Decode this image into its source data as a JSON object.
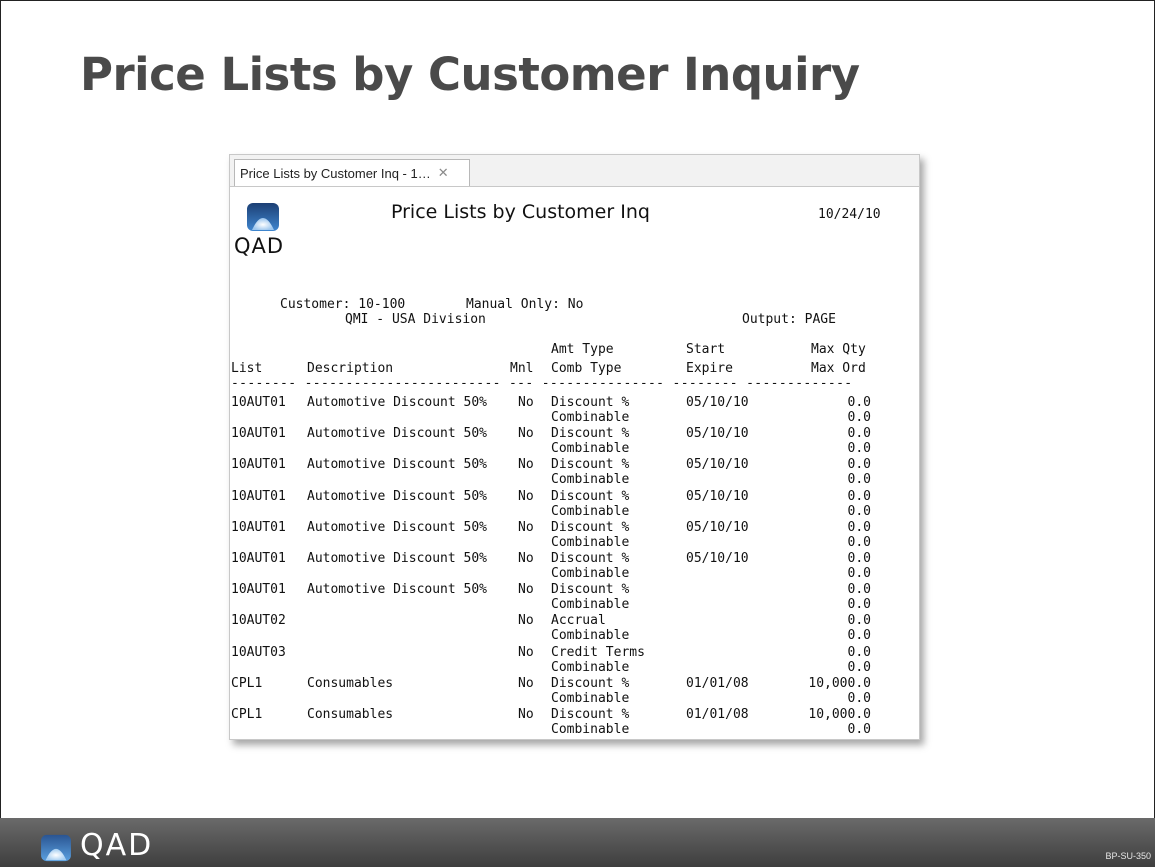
{
  "slide": {
    "title": "Price Lists by Customer Inquiry",
    "code": "BP-SU-350",
    "brand": "QAD"
  },
  "window": {
    "tab_label": "Price Lists by Customer Inq - 1…",
    "close_glyph": "✕",
    "logo_text": "QAD",
    "report_title": "Price Lists by Customer Inq",
    "report_date": "10/24/10"
  },
  "criteria": {
    "customer": "Customer: 10-100",
    "customer_name": "QMI - USA Division",
    "manual_only": "Manual Only: No",
    "output": "Output: PAGE"
  },
  "table": {
    "header_top": {
      "amt_type": "Amt Type",
      "start": "Start",
      "max_qty": "Max Qty"
    },
    "header_bottom": {
      "list": "List",
      "description": "Description",
      "mnl": "Mnl",
      "comb_type": "Comb Type",
      "expire": "Expire",
      "max_ord": "Max Ord"
    },
    "separator": "-------- ------------------------ --- --------------- -------- -------------",
    "rows": [
      {
        "list": "10AUT01",
        "description": "Automotive Discount 50%",
        "mnl": "No",
        "amt_type": "Discount %",
        "comb_type": "Combinable",
        "start": "05/10/10",
        "expire": "",
        "max_qty": "0.0",
        "max_ord": "0.0"
      },
      {
        "list": "10AUT01",
        "description": "Automotive Discount 50%",
        "mnl": "No",
        "amt_type": "Discount %",
        "comb_type": "Combinable",
        "start": "05/10/10",
        "expire": "",
        "max_qty": "0.0",
        "max_ord": "0.0"
      },
      {
        "list": "10AUT01",
        "description": "Automotive Discount 50%",
        "mnl": "No",
        "amt_type": "Discount %",
        "comb_type": "Combinable",
        "start": "05/10/10",
        "expire": "",
        "max_qty": "0.0",
        "max_ord": "0.0"
      },
      {
        "list": "10AUT01",
        "description": "Automotive Discount 50%",
        "mnl": "No",
        "amt_type": "Discount %",
        "comb_type": "Combinable",
        "start": "05/10/10",
        "expire": "",
        "max_qty": "0.0",
        "max_ord": "0.0"
      },
      {
        "list": "10AUT01",
        "description": "Automotive Discount 50%",
        "mnl": "No",
        "amt_type": "Discount %",
        "comb_type": "Combinable",
        "start": "05/10/10",
        "expire": "",
        "max_qty": "0.0",
        "max_ord": "0.0"
      },
      {
        "list": "10AUT01",
        "description": "Automotive Discount 50%",
        "mnl": "No",
        "amt_type": "Discount %",
        "comb_type": "Combinable",
        "start": "05/10/10",
        "expire": "",
        "max_qty": "0.0",
        "max_ord": "0.0"
      },
      {
        "list": "10AUT01",
        "description": "Automotive Discount 50%",
        "mnl": "No",
        "amt_type": "Discount %",
        "comb_type": "Combinable",
        "start": "",
        "expire": "",
        "max_qty": "0.0",
        "max_ord": "0.0"
      },
      {
        "list": "10AUT02",
        "description": "",
        "mnl": "No",
        "amt_type": "Accrual",
        "comb_type": "Combinable",
        "start": "",
        "expire": "",
        "max_qty": "0.0",
        "max_ord": "0.0"
      },
      {
        "list": "10AUT03",
        "description": "",
        "mnl": "No",
        "amt_type": "Credit Terms",
        "comb_type": "Combinable",
        "start": "",
        "expire": "",
        "max_qty": "0.0",
        "max_ord": "0.0"
      },
      {
        "list": "CPL1",
        "description": "Consumables",
        "mnl": "No",
        "amt_type": "Discount %",
        "comb_type": "Combinable",
        "start": "01/01/08",
        "expire": "",
        "max_qty": "10,000.0",
        "max_ord": "0.0"
      },
      {
        "list": "CPL1",
        "description": "Consumables",
        "mnl": "No",
        "amt_type": "Discount %",
        "comb_type": "Combinable",
        "start": "01/01/08",
        "expire": "",
        "max_qty": "10,000.0",
        "max_ord": "0.0"
      }
    ]
  },
  "colors": {
    "title_gray": "#4a4a4a",
    "footer_dark": "#3e3e3e",
    "logo_blue": "#2f6fb5"
  },
  "icons": {
    "logo": "qad-logo-icon",
    "close": "close-icon"
  }
}
